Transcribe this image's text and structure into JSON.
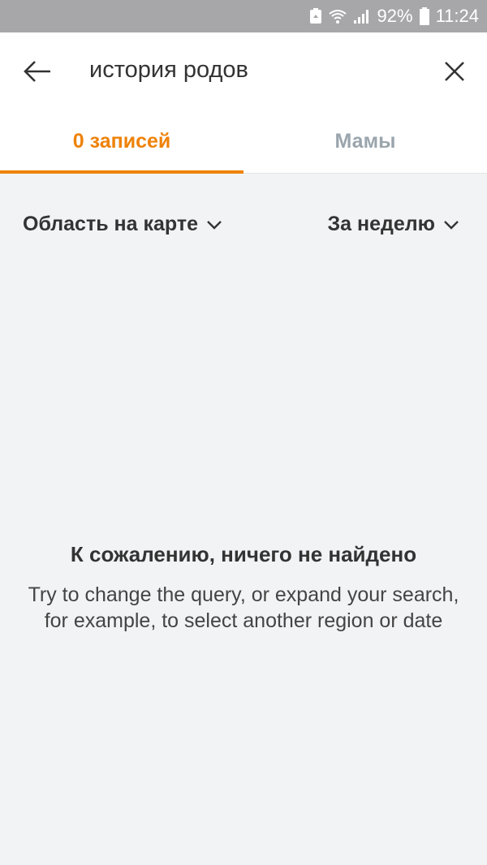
{
  "status_bar": {
    "battery_percent": "92%",
    "time": "11:24",
    "icons": [
      "recycle-icon",
      "wifi-icon",
      "signal-icon",
      "battery-icon"
    ]
  },
  "header": {
    "query": "история родов",
    "back_icon": "arrow-left-icon",
    "close_icon": "close-icon"
  },
  "tabs": [
    {
      "label": "0 записей",
      "active": true
    },
    {
      "label": "Мамы",
      "active": false
    }
  ],
  "filters": {
    "region": "Область на карте",
    "period": "За неделю"
  },
  "empty_state": {
    "title": "К сожалению, ничего не найдено",
    "description": "Try to change the query, or expand your search, for example, to select another region or date"
  },
  "colors": {
    "accent": "#ee8208",
    "inactive_tab": "#9aa5ad",
    "background": "#f2f3f5",
    "status_bar": "#a7a7a9"
  }
}
